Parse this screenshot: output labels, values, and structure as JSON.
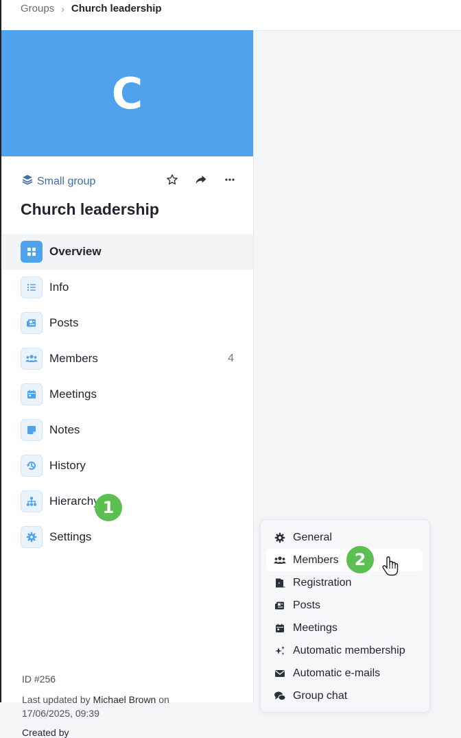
{
  "breadcrumb": {
    "root": "Groups",
    "current": "Church leadership"
  },
  "banner": {
    "letter": "C",
    "color": "#4fa3ec"
  },
  "group": {
    "type": "Small group",
    "title": "Church leadership"
  },
  "nav": [
    {
      "label": "Overview",
      "icon": "grid-icon",
      "active": true
    },
    {
      "label": "Info",
      "icon": "list-icon"
    },
    {
      "label": "Posts",
      "icon": "newspaper-icon"
    },
    {
      "label": "Members",
      "icon": "users-icon",
      "count": "4"
    },
    {
      "label": "Meetings",
      "icon": "calendar-icon"
    },
    {
      "label": "Notes",
      "icon": "sticky-note-icon"
    },
    {
      "label": "History",
      "icon": "history-icon"
    },
    {
      "label": "Hierarchy",
      "icon": "sitemap-icon"
    },
    {
      "label": "Settings",
      "icon": "gear-icon"
    }
  ],
  "steps": {
    "first": "1",
    "second": "2"
  },
  "meta": {
    "id": "ID #256",
    "updated_prefix": "Last updated by",
    "updated_by": "Michael Brown",
    "updated_on": "on",
    "updated_at": "17/06/2025, 09:39",
    "cut_text": "Created by"
  },
  "settings_menu": [
    {
      "label": "General",
      "icon": "gear-icon"
    },
    {
      "label": "Members",
      "icon": "users-icon",
      "hover": true
    },
    {
      "label": "Registration",
      "icon": "door-icon"
    },
    {
      "label": "Posts",
      "icon": "newspaper-icon"
    },
    {
      "label": "Meetings",
      "icon": "calendar-icon"
    },
    {
      "label": "Automatic membership",
      "icon": "sparkles-icon"
    },
    {
      "label": "Automatic e-mails",
      "icon": "envelope-icon"
    },
    {
      "label": "Group chat",
      "icon": "chat-icon"
    }
  ],
  "colors": {
    "accent": "#4fa3ec",
    "badge": "#5cbf52",
    "nav_icon_bg": "#eaf3fc",
    "type_text": "#3d6ea6"
  }
}
